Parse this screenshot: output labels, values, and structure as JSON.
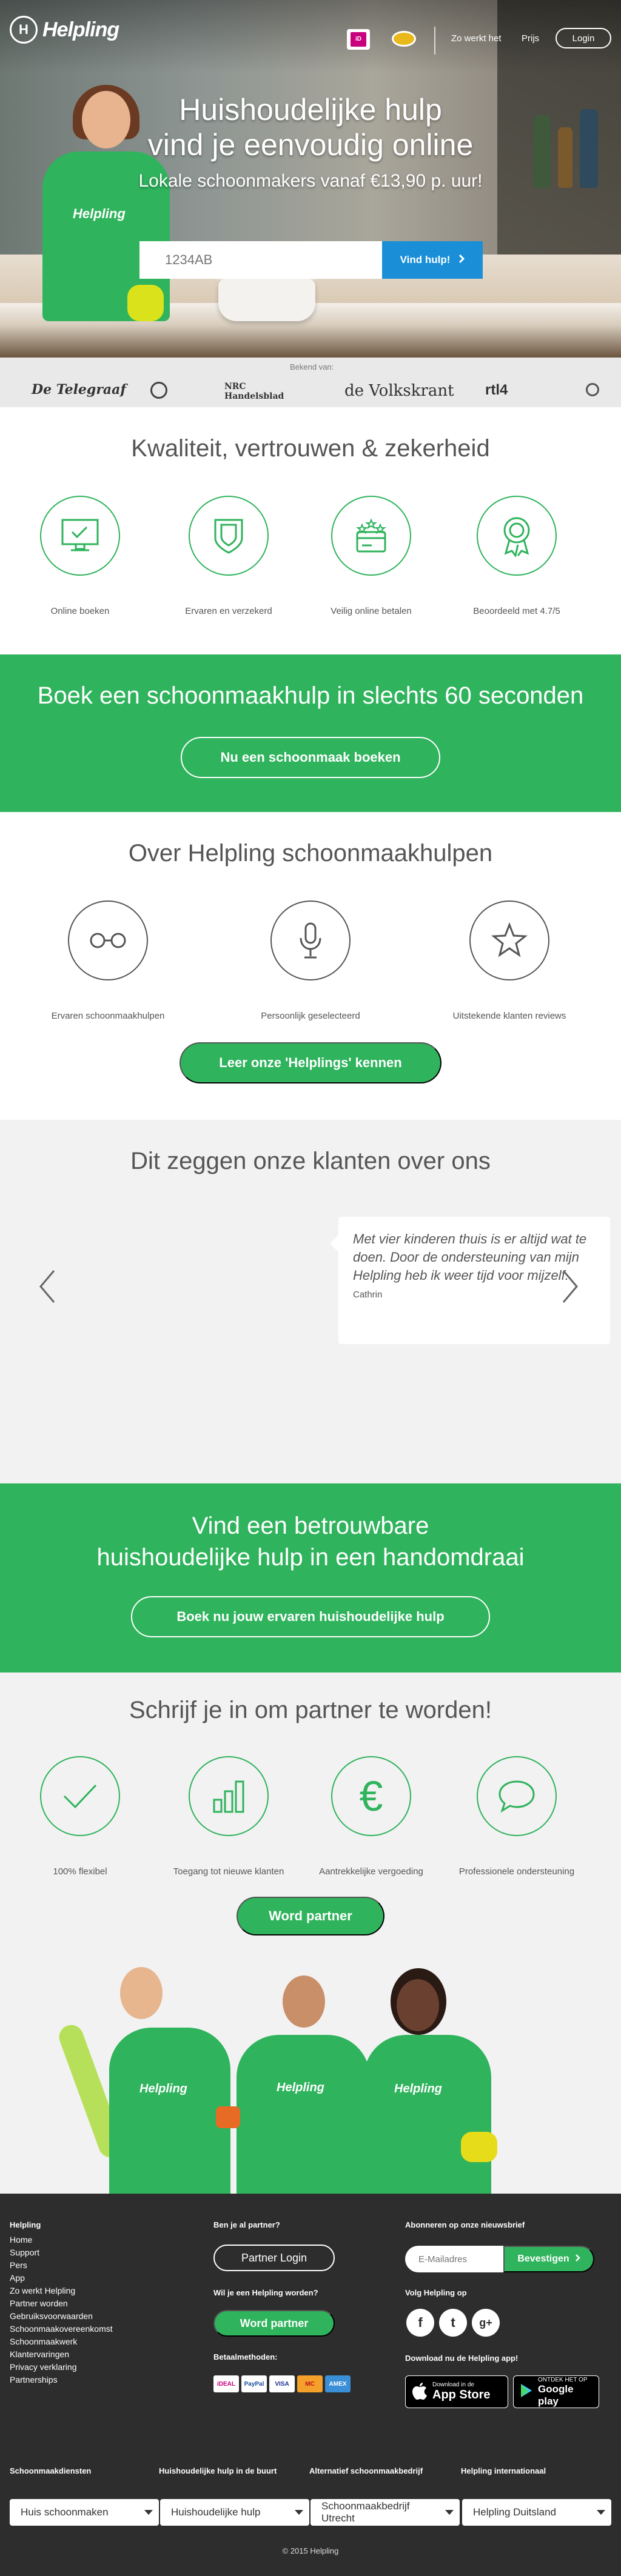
{
  "header": {
    "brand": "Helpling",
    "brand_mark": "H",
    "nav": [
      "Zo werkt het",
      "Prijs"
    ],
    "login": "Login"
  },
  "hero": {
    "title_line1": "Huishoudelijke hulp",
    "title_line2": "vind je eenvoudig online",
    "subtitle": "Lokale schoonmakers vanaf €13,90 p. uur!",
    "zip_placeholder": "1234AB",
    "cta": "Vind hulp!",
    "shirt_logo": "Helpling"
  },
  "press": {
    "label": "Bekend van:",
    "logos": [
      "De Telegraaf",
      "NRC Handelsblad",
      "de Volkskrant",
      "rtl4"
    ]
  },
  "quality": {
    "title": "Kwaliteit, vertrouwen & zekerheid",
    "items": [
      "Online boeken",
      "Ervaren en verzekerd",
      "Veilig online betalen",
      "Beoordeeld met 4.7/5"
    ]
  },
  "book_band": {
    "title": "Boek een schoonmaakhulp in slechts 60 seconden",
    "button": "Nu een schoonmaak boeken"
  },
  "about": {
    "title": "Over Helpling schoonmaakhulpen",
    "items": [
      "Ervaren schoonmaakhulpen",
      "Persoonlijk geselecteerd",
      "Uitstekende klanten reviews"
    ],
    "button": "Leer onze 'Helplings' kennen"
  },
  "testimonials": {
    "title": "Dit zeggen onze klanten over ons",
    "quote": "Met vier kinderen thuis is er altijd wat te doen. Door de ondersteuning van mijn Helpling heb ik weer tijd voor mijzelf.",
    "author": "Cathrin"
  },
  "trust_band": {
    "title_line1": "Vind een betrouwbare",
    "title_line2": "huishoudelijke hulp in een handomdraai",
    "button": "Boek nu jouw ervaren huishoudelijke hulp"
  },
  "partner": {
    "title": "Schrijf je in om partner te worden!",
    "items": [
      "100% flexibel",
      "Toegang tot nieuwe klanten",
      "Aantrekkelijke vergoeding",
      "Professionele ondersteuning"
    ],
    "euro": "€",
    "button": "Word partner",
    "shirt_logo": "Helpling"
  },
  "footer": {
    "col1_title": "Helpling",
    "links": [
      "Home",
      "Support",
      "Pers",
      "App",
      "Zo werkt Helpling",
      "Partner worden",
      "Gebruiksvoorwaarden",
      "Schoonmaakovereenkomst",
      "Schoonmaakwerk",
      "Klantervaringen",
      "Privacy verklaring",
      "Partnerships"
    ],
    "partner_q": "Ben je al partner?",
    "partner_login": "Partner Login",
    "become_q": "Wil je een Helpling worden?",
    "become_btn": "Word partner",
    "payment_title": "Betaalmethoden:",
    "payments": [
      "iDEAL",
      "PayPal",
      "VISA",
      "MC",
      "AMEX"
    ],
    "newsletter_title": "Abonneren op onze nieuwsbrief",
    "email_placeholder": "E-Mailadres",
    "subscribe": "Bevestigen",
    "follow_title": "Volg Helpling op",
    "social": [
      "f",
      "t",
      "g+"
    ],
    "app_title": "Download nu de Helpling app!",
    "appstore_small": "Download in de",
    "appstore_big": "App Store",
    "play_small": "ONTDEK HET OP",
    "play_big": "Google play",
    "selects": [
      {
        "title": "Schoonmaakdiensten",
        "value": "Huis schoonmaken"
      },
      {
        "title": "Huishoudelijke hulp in de buurt",
        "value": "Huishoudelijke hulp"
      },
      {
        "title": "Alternatief schoonmaakbedrijf",
        "value": "Schoonmaakbedrijf Utrecht"
      },
      {
        "title": "Helpling internationaal",
        "value": "Helpling Duitsland"
      }
    ],
    "copyright": "© 2015 Helpling"
  },
  "colors": {
    "brand_green": "#2fb35c",
    "cta_blue": "#1a8fd8",
    "footer_bg": "#2d2d2d"
  }
}
